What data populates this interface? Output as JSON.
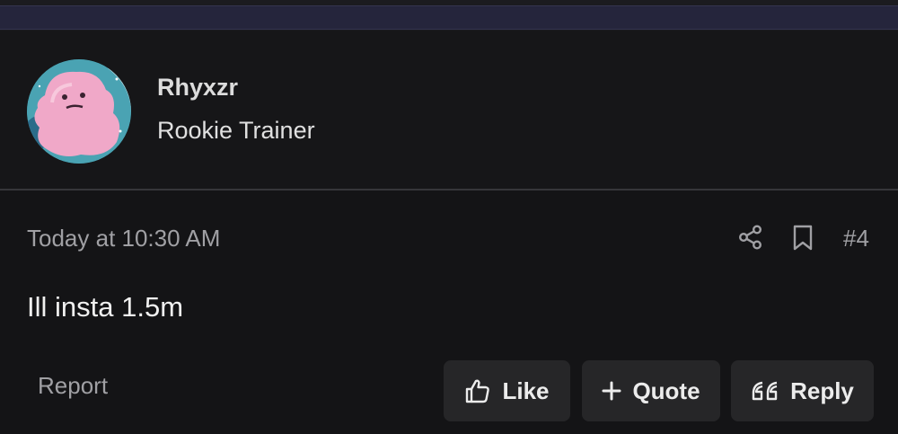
{
  "user": {
    "name": "Rhyxzr",
    "title": "Rookie Trainer",
    "avatar": "ditto-pokemon-avatar"
  },
  "post": {
    "timestamp": "Today at 10:30 AM",
    "number": "#4",
    "message": "Ill insta 1.5m"
  },
  "actions": {
    "report_label": "Report",
    "like_label": "Like",
    "quote_label": "Quote",
    "reply_label": "Reply"
  },
  "icons": {
    "share": "share-icon",
    "bookmark": "bookmark-icon",
    "like": "thumbs-up-icon",
    "quote": "plus-icon",
    "reply": "quote-marks-icon"
  },
  "colors": {
    "background": "#141416",
    "header_band": "#25253c",
    "button_bg": "#262628",
    "muted_text": "#a0a0a4"
  }
}
